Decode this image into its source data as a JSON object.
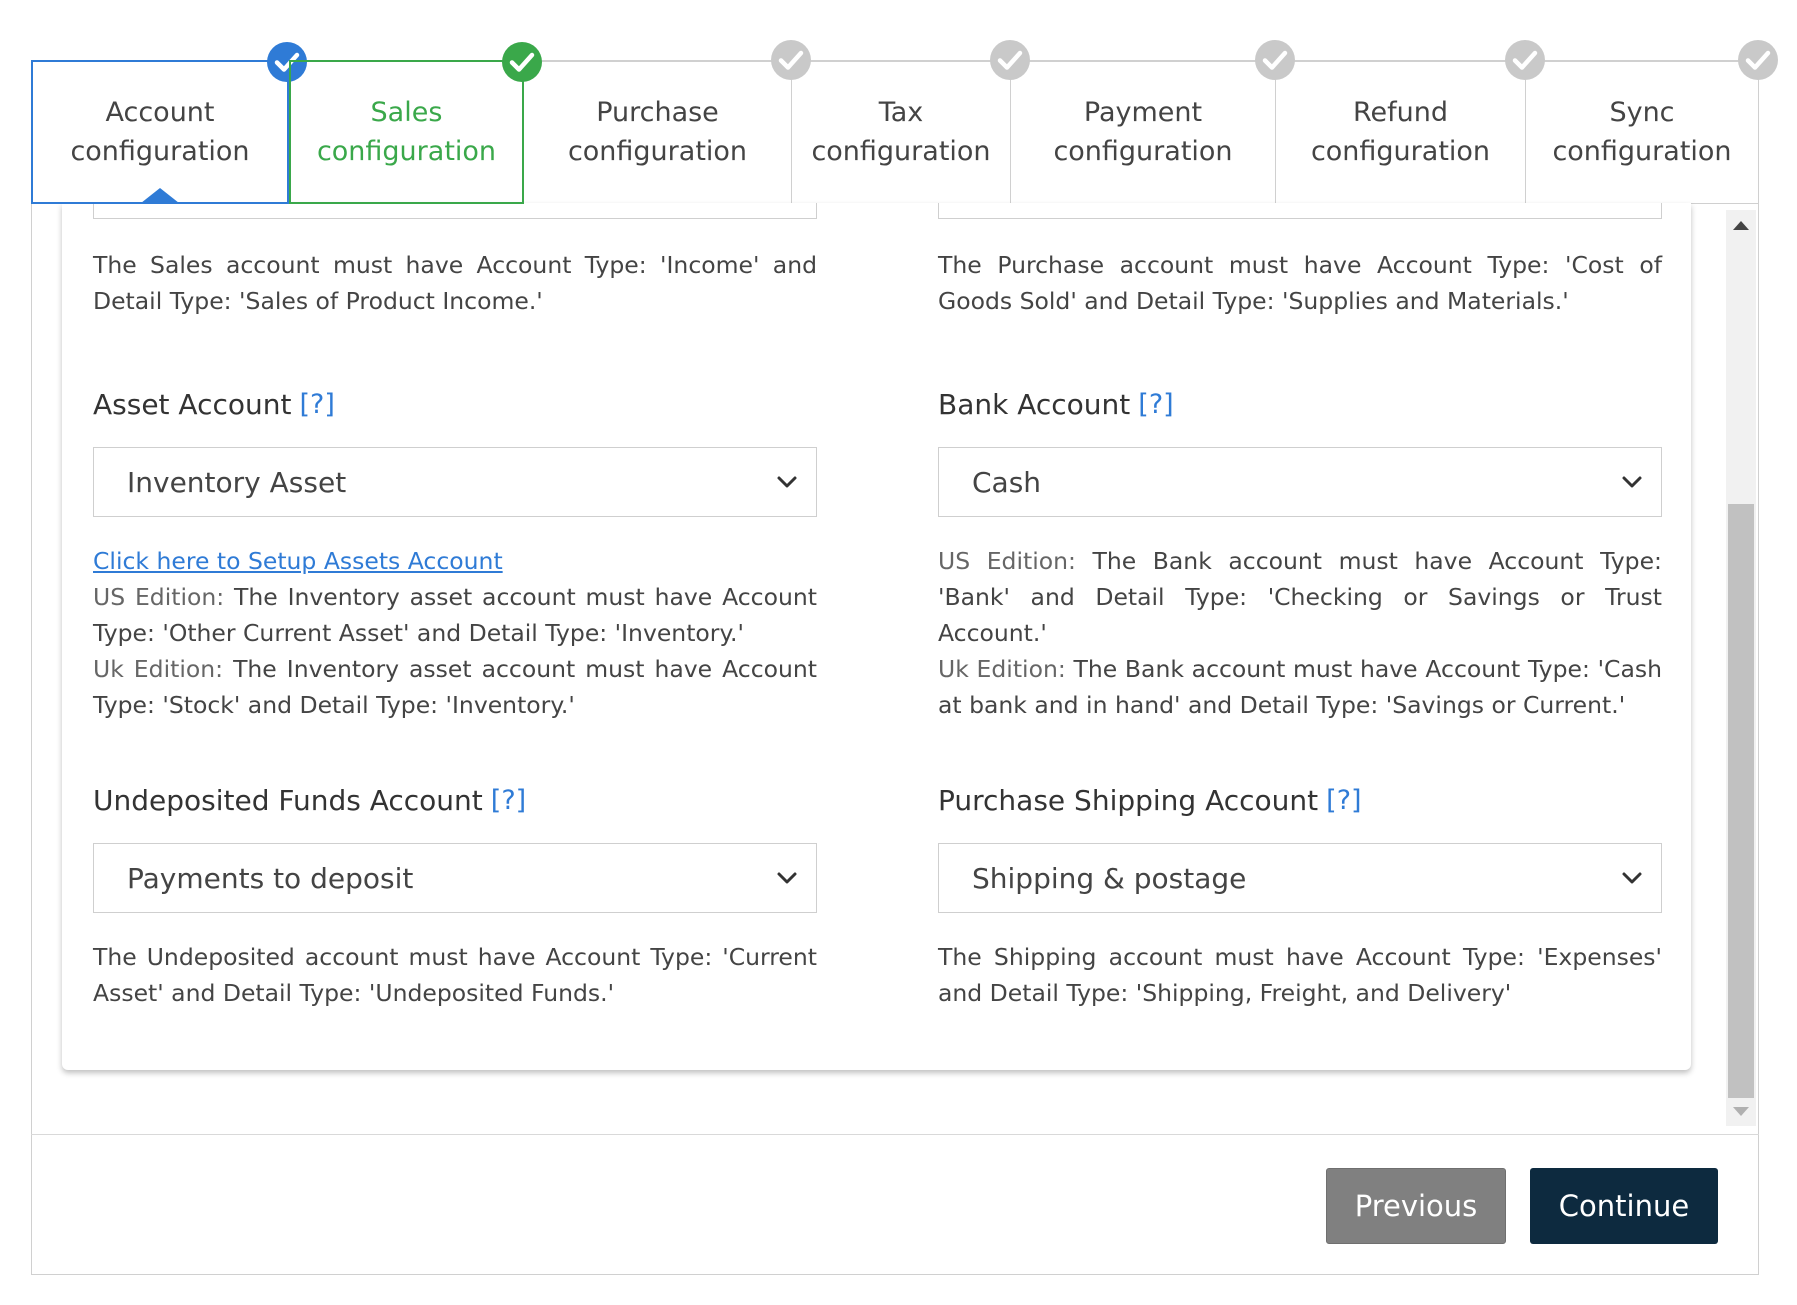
{
  "stepper": {
    "steps": [
      {
        "label": "Account\nconfiguration",
        "state": "active-complete"
      },
      {
        "label": "Sales\nconfiguration",
        "state": "complete"
      },
      {
        "label": "Purchase\nconfiguration",
        "state": "pending"
      },
      {
        "label": "Tax\nconfiguration",
        "state": "pending"
      },
      {
        "label": "Payment\nconfiguration",
        "state": "pending"
      },
      {
        "label": "Refund\nconfiguration",
        "state": "pending"
      },
      {
        "label": "Sync\nconfiguration",
        "state": "pending"
      }
    ]
  },
  "left": {
    "sales_note": "The Sales account must have Account Type: 'Income' and Detail Type: 'Sales of Product Income.'",
    "asset": {
      "label": "Asset Account",
      "help": "[?]",
      "value": "Inventory Asset",
      "setup_link": "Click here to Setup Assets Account",
      "us_prefix": "US Edition:",
      "us_text": "The Inventory asset account must have Account Type: 'Other Current Asset' and Detail Type: 'Inventory.'",
      "uk_prefix": "Uk Edition:",
      "uk_text": "The Inventory asset account must have Account Type: 'Stock' and Detail Type: 'Inventory.'"
    },
    "undeposited": {
      "label": "Undeposited Funds Account",
      "help": "[?]",
      "value": "Payments to deposit",
      "note": "The Undeposited account must have Account Type: 'Current Asset' and Detail Type: 'Undeposited Funds.'"
    }
  },
  "right": {
    "purchase_note": "The Purchase account must have Account Type: 'Cost of Goods Sold' and Detail Type: 'Supplies and Materials.'",
    "bank": {
      "label": "Bank Account",
      "help": "[?]",
      "value": "Cash",
      "us_prefix": "US Edition:",
      "us_text": "The Bank account must have Account Type: 'Bank' and Detail Type: 'Checking or Savings or Trust Account.'",
      "uk_prefix": "Uk Edition:",
      "uk_text": "The Bank account must have Account Type: 'Cash at bank and in hand' and Detail Type: 'Savings or Current.'"
    },
    "shipping": {
      "label": "Purchase Shipping Account",
      "help": "[?]",
      "value": "Shipping & postage",
      "note": "The Shipping account must have Account Type: 'Expenses' and Detail Type: 'Shipping, Freight, and Delivery'"
    }
  },
  "footer": {
    "previous_label": "Previous",
    "continue_label": "Continue"
  },
  "colors": {
    "accent_blue": "#2f7bd6",
    "complete_green": "#3aa84a",
    "pending_gray": "#c9c9c9",
    "continue_bg": "#0d2a3f",
    "previous_bg": "#808080"
  }
}
